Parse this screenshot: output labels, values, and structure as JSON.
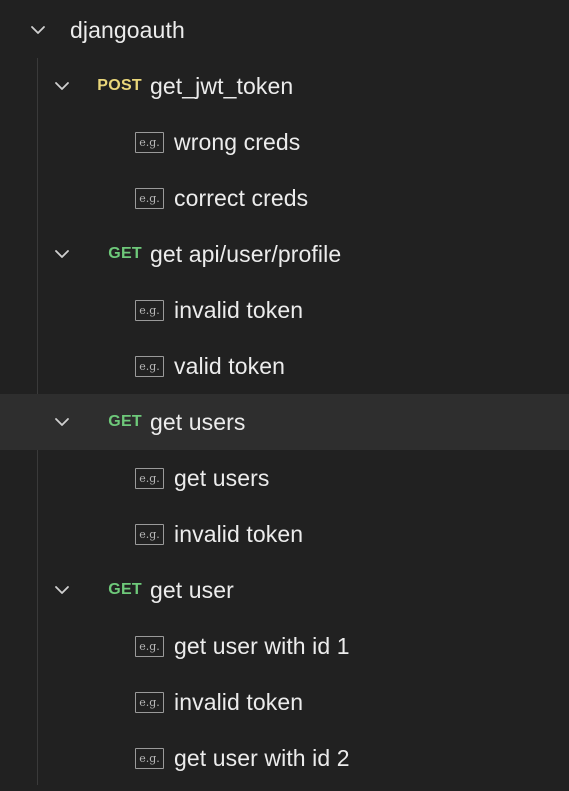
{
  "collection": {
    "name": "djangoauth",
    "folders": [
      {
        "method": "POST",
        "name": "get_jwt_token",
        "examples": [
          "wrong creds",
          "correct creds"
        ]
      },
      {
        "method": "GET",
        "name": "get api/user/profile",
        "examples": [
          "invalid token",
          "valid token"
        ]
      },
      {
        "method": "GET",
        "name": "get users",
        "highlighted": true,
        "examples": [
          "get users",
          "invalid token"
        ]
      },
      {
        "method": "GET",
        "name": "get user",
        "examples": [
          "get user with id 1",
          "invalid token",
          "get user with id 2"
        ]
      }
    ]
  },
  "icons": {
    "chevron": "chevron-down-icon",
    "example": "example-icon",
    "example_glyph": "e.g."
  },
  "colors": {
    "background": "#212121",
    "highlight": "#2e2e2e",
    "post": "#e9d67a",
    "get": "#6ec97a",
    "text": "#ececec"
  }
}
